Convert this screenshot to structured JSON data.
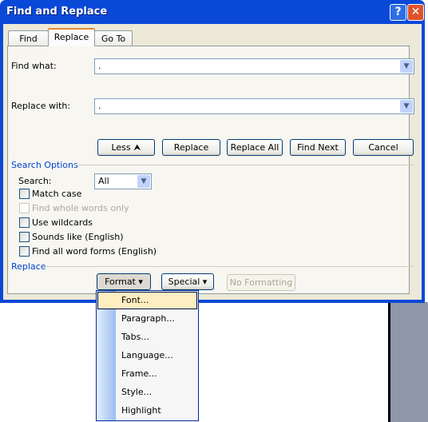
{
  "window": {
    "title": "Find and Replace",
    "help_icon": "?",
    "close_icon": "✕"
  },
  "tabs": [
    {
      "label": "Find"
    },
    {
      "label": "Replace",
      "active": true
    },
    {
      "label": "Go To"
    }
  ],
  "find": {
    "label": "Find what:",
    "value": "."
  },
  "replace": {
    "label": "Replace with:",
    "value": "."
  },
  "buttons": {
    "less": "Less ⮝",
    "replace": "Replace",
    "replace_all": "Replace All",
    "find_next": "Find Next",
    "cancel": "Cancel"
  },
  "search_options": {
    "heading": "Search Options",
    "search_label": "Search:",
    "search_value": "All",
    "checkboxes": [
      {
        "label": "Match case",
        "checked": false,
        "enabled": true
      },
      {
        "label": "Find whole words only",
        "checked": false,
        "enabled": false
      },
      {
        "label": "Use wildcards",
        "checked": false,
        "enabled": true
      },
      {
        "label": "Sounds like (English)",
        "checked": false,
        "enabled": true
      },
      {
        "label": "Find all word forms (English)",
        "checked": false,
        "enabled": true
      }
    ]
  },
  "replace_section": {
    "heading": "Replace",
    "format": "Format ▾",
    "special": "Special ▾",
    "no_formatting": "No Formatting"
  },
  "format_menu": {
    "items": [
      "Font...",
      "Paragraph...",
      "Tabs...",
      "Language...",
      "Frame...",
      "Style...",
      "Highlight"
    ],
    "highlighted": "Font..."
  }
}
